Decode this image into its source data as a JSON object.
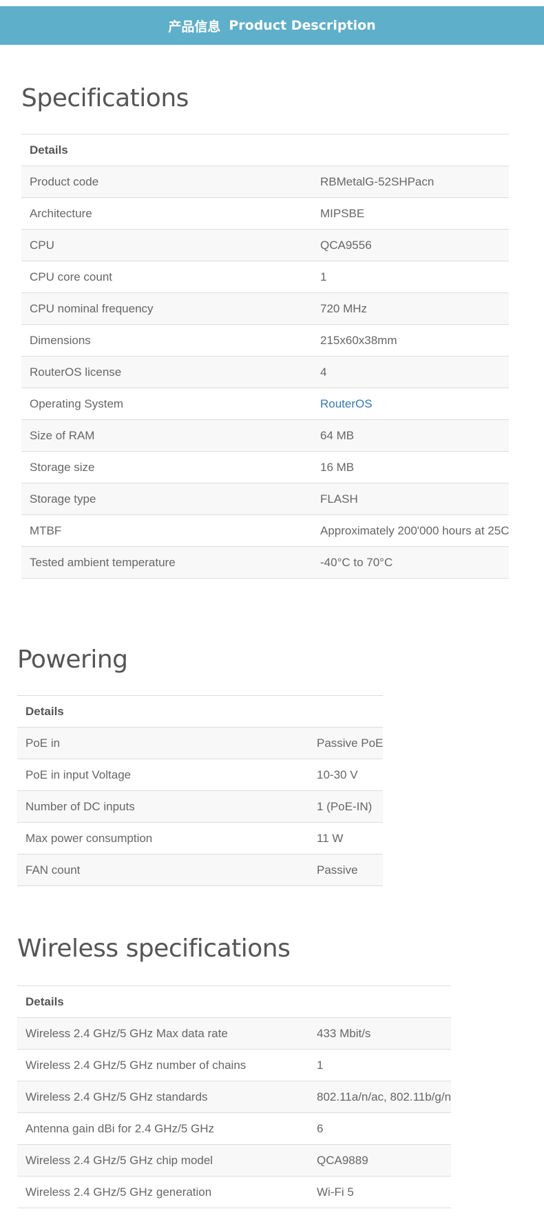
{
  "banner": {
    "cn": "产品信息",
    "en": "Product Description"
  },
  "sections": [
    {
      "title": "Specifications",
      "header": "Details",
      "rows": [
        [
          "Product code",
          "RBMetalG-52SHPacn"
        ],
        [
          "Architecture",
          "MIPSBE"
        ],
        [
          "CPU",
          "QCA9556"
        ],
        [
          "CPU core count",
          "1"
        ],
        [
          "CPU nominal frequency",
          "720 MHz"
        ],
        [
          "Dimensions",
          "215x60x38mm"
        ],
        [
          "RouterOS license",
          "4"
        ],
        [
          "Operating System",
          "RouterOS"
        ],
        [
          "Size of RAM",
          "64 MB"
        ],
        [
          "Storage size",
          "16 MB"
        ],
        [
          "Storage type",
          "FLASH"
        ],
        [
          "MTBF",
          "Approximately 200'000 hours at 25C"
        ],
        [
          "Tested ambient temperature",
          "-40°C to 70°C"
        ]
      ]
    },
    {
      "title": "Powering",
      "header": "Details",
      "rows": [
        [
          "PoE in",
          "Passive PoE"
        ],
        [
          "PoE in input Voltage",
          "10-30 V"
        ],
        [
          "Number of DC inputs",
          "1 (PoE-IN)"
        ],
        [
          "Max power consumption",
          "11 W"
        ],
        [
          "FAN count",
          "Passive"
        ]
      ]
    },
    {
      "title": "Wireless specifications",
      "header": "Details",
      "rows": [
        [
          "Wireless 2.4 GHz/5 GHz Max data rate",
          "433 Mbit/s"
        ],
        [
          "Wireless 2.4 GHz/5 GHz number of chains",
          "1"
        ],
        [
          "Wireless 2.4 GHz/5 GHz standards",
          "802.11a/n/ac, 802.11b/g/n"
        ],
        [
          "Antenna gain dBi for 2.4 GHz/5 GHz",
          "6"
        ],
        [
          "Wireless 2.4 GHz/5 GHz chip model",
          "QCA9889"
        ],
        [
          "Wireless 2.4 GHz/5 GHz generation",
          "Wi-Fi 5"
        ]
      ]
    }
  ],
  "link_color": "#337ab7"
}
